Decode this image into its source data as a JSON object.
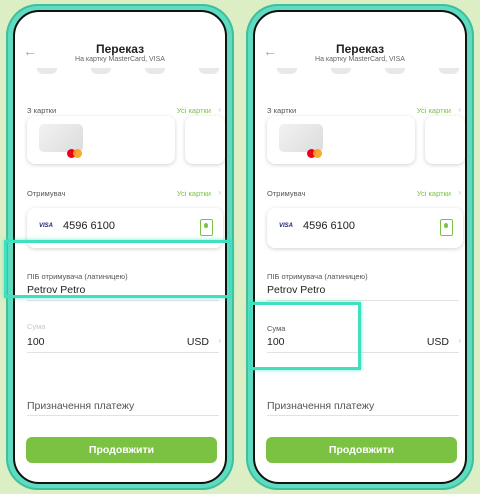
{
  "header": {
    "title": "Переказ",
    "subtitle": "На картку MasterCard, VISA"
  },
  "from_section": {
    "label": "З картки",
    "link": "Усі картки"
  },
  "recipient_section": {
    "label": "Отримувач",
    "link": "Усі картки",
    "card_brand": "VISA",
    "card_number": "4596 6100"
  },
  "name_field": {
    "label": "ПІБ отримувача (латиницею)",
    "value": "Petrov Petro"
  },
  "amount_field": {
    "label": "Сума",
    "value": "100",
    "currency": "USD"
  },
  "purpose_field": {
    "placeholder": "Призначення платежу"
  },
  "continue_button": {
    "label": "Продовжити"
  },
  "icons": {
    "back": "arrow-left-icon",
    "chevron": "chevron-right-icon",
    "contacts": "contacts-book-icon",
    "card": "mastercard-logo-icon"
  },
  "colors": {
    "accent": "#7cc242",
    "highlight": "#3ee0c0",
    "phone_frame": "#5fdcc0",
    "background": "#dbeec4"
  }
}
